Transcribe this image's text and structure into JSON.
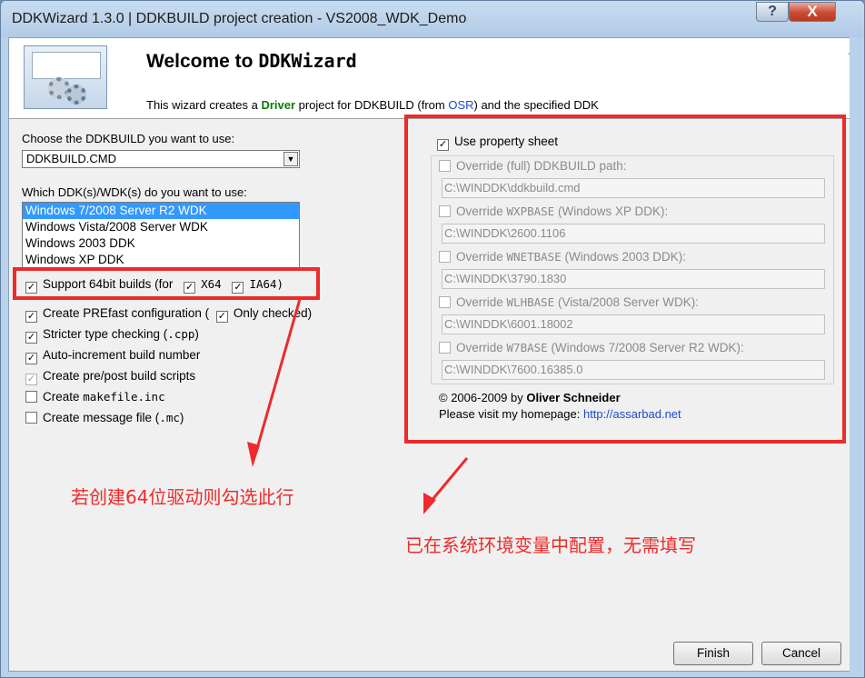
{
  "window": {
    "title": "DDKWizard 1.3.0 | DDKBUILD project creation - VS2008_WDK_Demo",
    "help_glyph": "?",
    "close_glyph": "X"
  },
  "banner": {
    "welcome_prefix": "Welcome to ",
    "welcome_mono": "DDKWizard",
    "sub_pre": "This wizard creates a ",
    "sub_driver": "Driver",
    "sub_mid": " project for DDKBUILD (from ",
    "sub_osr": "OSR",
    "sub_post": ") and the specified DDK"
  },
  "left": {
    "choose_label": "Choose the DDKBUILD you want to use:",
    "combo_value": "DDKBUILD.CMD",
    "which_label": "Which DDK(s)/WDK(s) do you want to use:",
    "ddk_list": [
      "Windows 7/2008 Server R2 WDK",
      "Windows Vista/2008 Server WDK",
      "Windows 2003 DDK",
      "Windows XP DDK"
    ],
    "support64_label": "Support 64bit builds (for",
    "x64": "X64",
    "ia64": "IA64)",
    "prefast_label": "Create PREfast configuration (",
    "only_checked": "Only checked)",
    "stricter_pre": "Stricter type checking (",
    "stricter_mono": ".cpp",
    "stricter_post": ")",
    "autoinc_label": "Auto-increment build number",
    "prepost_label": "Create pre/post build scripts",
    "makefile_pre": "Create ",
    "makefile_mono": "makefile.inc",
    "message_pre": "Create message file (",
    "message_mono": ".mc",
    "message_post": ")"
  },
  "right": {
    "use_property_sheet": "Use property sheet",
    "overrides": [
      {
        "label_pre": "Override (full) DDKBUILD path:",
        "label_mono": "",
        "label_post": "",
        "value": "C:\\WINDDK\\ddkbuild.cmd"
      },
      {
        "label_pre": "Override ",
        "label_mono": "WXPBASE",
        "label_post": " (Windows XP DDK):",
        "value": "C:\\WINDDK\\2600.1106"
      },
      {
        "label_pre": "Override ",
        "label_mono": "WNETBASE",
        "label_post": " (Windows 2003 DDK):",
        "value": "C:\\WINDDK\\3790.1830"
      },
      {
        "label_pre": "Override ",
        "label_mono": "WLHBASE",
        "label_post": " (Vista/2008 Server WDK):",
        "value": "C:\\WINDDK\\6001.18002"
      },
      {
        "label_pre": "Override ",
        "label_mono": "W7BASE",
        "label_post": " (Windows 7/2008 Server R2 WDK):",
        "value": "C:\\WINDDK\\7600.16385.0"
      }
    ],
    "copyright_pre": "© 2006-2009 by ",
    "copyright_name": "Oliver Schneider",
    "visit_pre": "Please visit my homepage: ",
    "visit_url": "http://assarbad.net"
  },
  "annotations": {
    "left_note": "若创建64位驱动则勾选此行",
    "right_note": "已在系统环境变量中配置，无需填写",
    "color": "#ee2a2a"
  },
  "buttons": {
    "finish": "Finish",
    "cancel": "Cancel"
  }
}
